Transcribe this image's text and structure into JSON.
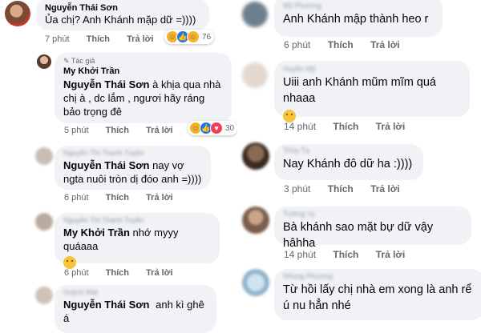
{
  "left": [
    {
      "name": "Nguyễn Thái Sơn",
      "text": "Ủa chị? Anh Khánh mặp dữ =))))",
      "time": "7 phút",
      "like": "Thích",
      "reply": "Trả lời",
      "react_count": "76",
      "blur": ""
    },
    {
      "author_tag": "Tác giả",
      "name": "My Khởi Trần",
      "tag": "Nguyễn Thái Sơn",
      "text": "à khịa qua nhà chị à , dc lắm , ngươi hãy ráng bảo trọng đê",
      "time": "5 phút",
      "like": "Thích",
      "reply": "Trả lời",
      "react_count": "30"
    },
    {
      "blur": "Nguyễn Thị Thanh Tuyền",
      "tag": "Nguyễn Thái Sơn",
      "text": "nay vợ ngta nuôi tròn dị đóo anh =))))",
      "time": "6 phút",
      "like": "Thích",
      "reply": "Trả lời"
    },
    {
      "blur": "Nguyễn Thị Thanh Tuyền",
      "tag": "My Khởi Trần",
      "text": "nhớ myyy quáaaa",
      "time": "6 phút",
      "like": "Thích",
      "reply": "Trả lời"
    },
    {
      "blur": "Huỳnh Mai",
      "tag": "Nguyễn Thái Sơn",
      "text": "anh kì ghê á"
    }
  ],
  "right": [
    {
      "blur": "Mỹ Phương",
      "text": "Anh Khánh mập thành heo r",
      "time": "6 phút",
      "like": "Thích",
      "reply": "Trả lời"
    },
    {
      "blur": "Huyền Mỹ",
      "text": "Uiii anh Khánh mũm mĩm quá nhaaa",
      "time": "14 phút",
      "like": "Thích",
      "reply": "Trả lời"
    },
    {
      "blur": "Thủy Tạ",
      "text": "Nay Khánh đô dữ ha :))))",
      "time": "3 phút",
      "like": "Thích",
      "reply": "Trả lời"
    },
    {
      "blur": "Tường Vy",
      "text": "Bà khánh sao mặt bự dữ vậy hâhha",
      "time": "14 phút",
      "like": "Thích",
      "reply": "Trả lời"
    },
    {
      "blur": "Nhung Phương",
      "text": "Từ hồi lấy chị nhà em xong là anh rể ú nu hẳn nhé"
    }
  ]
}
